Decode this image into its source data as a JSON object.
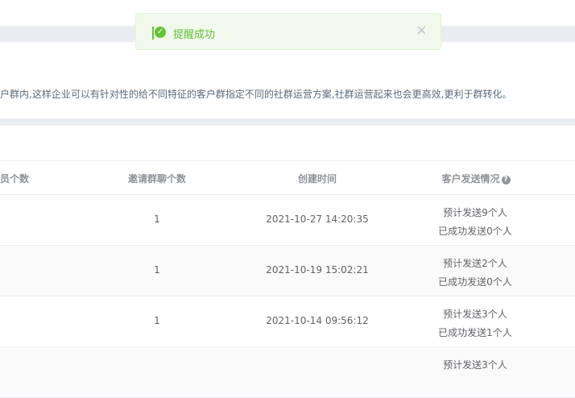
{
  "toast": {
    "message": "提醒成功",
    "close_symbol": "×",
    "color": "#67c23a"
  },
  "description": "户群内,这样企业可以有针对性的给不同特征的客户群指定不同的社群运营方案,社群运营起来也会更高效,更利于群转化。",
  "table": {
    "headers": {
      "members": "员个数",
      "groups": "邀请群聊个数",
      "created": "创建时间",
      "send_status": "客户发送情况"
    },
    "rows": [
      {
        "groups": "1",
        "created": "2021-10-27 14:20:35",
        "planned": "预计发送9个人",
        "sent": "已成功发送0个人"
      },
      {
        "groups": "1",
        "created": "2021-10-19 15:02:21",
        "planned": "预计发送2个人",
        "sent": "已成功发送0个人"
      },
      {
        "groups": "1",
        "created": "2021-10-14 09:56:12",
        "planned": "预计发送3个人",
        "sent": "已成功发送1个人"
      },
      {
        "planned": "预计发送3个人"
      }
    ]
  }
}
